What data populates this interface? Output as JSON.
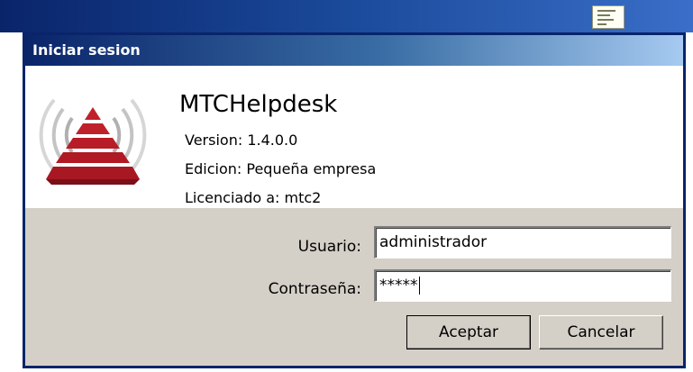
{
  "window": {
    "title": "Iniciar sesion"
  },
  "app": {
    "name": "MTCHelpdesk",
    "version": "Version: 1.4.0.0",
    "edition": "Edicion: Pequeña empresa",
    "license": "Licenciado a: mtc2",
    "logo_icon": "signal-pyramid-logo-icon"
  },
  "form": {
    "user_label": "Usuario:",
    "user_value": "administrador",
    "password_label": "Contraseña:",
    "password_value": "*****"
  },
  "buttons": {
    "ok": "Aceptar",
    "cancel": "Cancelar"
  },
  "colors": {
    "title_start": "#0a246a",
    "title_end": "#a6caf0",
    "logo_red": "#c0202a",
    "dialog_bg": "#d4d0c8"
  }
}
